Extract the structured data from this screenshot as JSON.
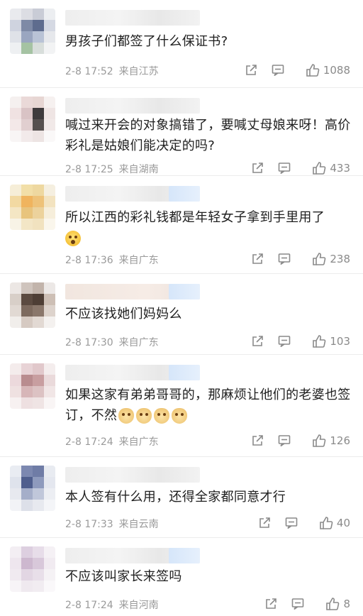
{
  "comments": [
    {
      "text": "男孩子们都签了什么保证书?",
      "time": "2-8 17:52",
      "loc": "来自江苏",
      "likes": "1088"
    },
    {
      "text": "喊过来开会的对象搞错了，要喊丈母娘来呀！高价彩礼是姑娘们能决定的吗?",
      "time": "2-8 17:25",
      "loc": "来自湖南",
      "likes": "433"
    },
    {
      "text": "所以江西的彩礼钱都是年轻女子拿到手里用了",
      "time": "2-8 17:36",
      "loc": "来自广东",
      "likes": "238"
    },
    {
      "text": "不应该找她们妈妈么",
      "time": "2-8 17:30",
      "loc": "来自广东",
      "likes": "103"
    },
    {
      "text": "如果这家有弟弟哥哥的，那麻烦让他们的老婆也签订，不然",
      "time": "2-8 17:24",
      "loc": "来自广东",
      "likes": "126"
    },
    {
      "text": "本人签有什么用，还得全家都同意才行",
      "time": "2-8 17:33",
      "loc": "来自云南",
      "likes": "40"
    },
    {
      "text": "不应该叫家长来签吗",
      "time": "2-8 17:24",
      "loc": "来自河南",
      "likes": "8"
    }
  ],
  "icons": {
    "share": "share-icon",
    "reply": "comment-icon",
    "like": "thumbs-up-icon",
    "emoji_shock": "shocked-face-emoji",
    "emoji_dog": "doge-emoji"
  }
}
